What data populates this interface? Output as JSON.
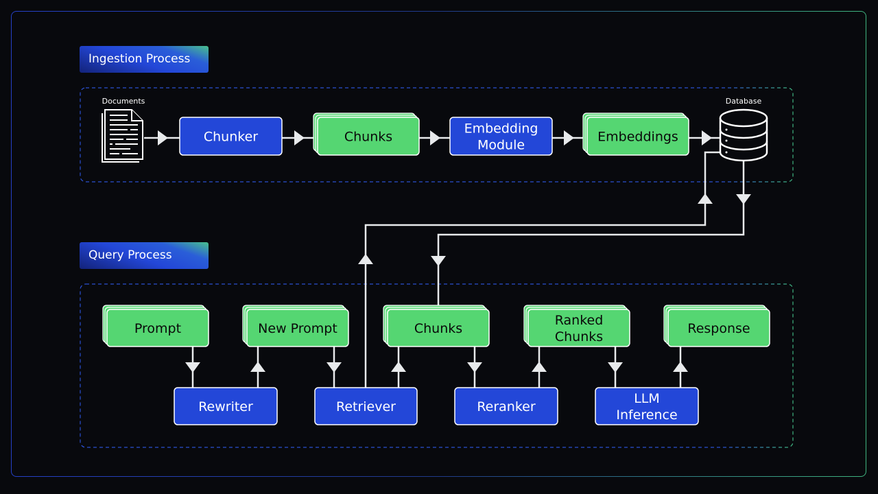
{
  "sections": {
    "ingestion": "Ingestion Process",
    "query": "Query Process"
  },
  "ingestion": {
    "documents_label": "Documents",
    "chunker": "Chunker",
    "chunks": "Chunks",
    "embedding_module": [
      "Embedding",
      "Module"
    ],
    "embeddings": "Embeddings",
    "database_label": "Database"
  },
  "query": {
    "prompt": "Prompt",
    "new_prompt": "New Prompt",
    "chunks": "Chunks",
    "ranked_chunks": [
      "Ranked",
      "Chunks"
    ],
    "response": "Response",
    "rewriter": "Rewriter",
    "retriever": "Retriever",
    "reranker": "Reranker",
    "llm_inference": [
      "LLM",
      "Inference"
    ]
  },
  "colors": {
    "process_box": "#2347d8",
    "data_box": "#55d672",
    "line": "#e8eaec"
  }
}
